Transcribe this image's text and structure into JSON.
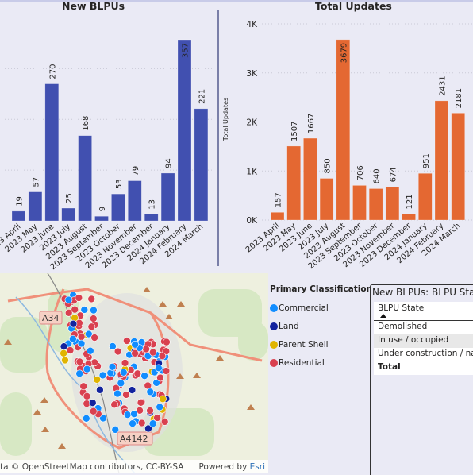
{
  "chart_data": [
    {
      "type": "bar",
      "title": "New BLPUs",
      "categories": [
        "2023 April",
        "2023 May",
        "2023 June",
        "2023 July",
        "2023 August",
        "2023 September",
        "2023 October",
        "2023 November",
        "2023 December",
        "2024 January",
        "2024 February",
        "2024 March"
      ],
      "values": [
        19,
        57,
        270,
        25,
        168,
        9,
        53,
        79,
        13,
        94,
        357,
        221
      ],
      "ylim": [
        0,
        357
      ],
      "grid": true,
      "color": "#4150b0",
      "xlabel": "",
      "ylabel": ""
    },
    {
      "type": "bar",
      "title": "Total Updates",
      "categories": [
        "2023 April",
        "2023 May",
        "2023 June",
        "2023 July",
        "2023 August",
        "2023 September",
        "2023 October",
        "2023 November",
        "2023 December",
        "2024 January",
        "2024 February",
        "2024 March"
      ],
      "values": [
        157,
        1507,
        1667,
        850,
        3679,
        706,
        640,
        674,
        121,
        951,
        2431,
        2181
      ],
      "ylim": [
        0,
        4000
      ],
      "yticks": [
        "0K",
        "1K",
        "2K",
        "3K",
        "4K"
      ],
      "grid": true,
      "color": "#e46832",
      "xlabel": "",
      "ylabel": "Total Updates"
    }
  ],
  "map": {
    "road_labels": [
      "A34",
      "A4142"
    ],
    "attribution": "ta © OpenStreetMap contributors, CC-BY-SA",
    "powered_by": "Powered by",
    "esri": "Esri"
  },
  "legend": {
    "title": "Primary Classification",
    "items": [
      {
        "label": "Commercial",
        "color": "#118dff"
      },
      {
        "label": "Land",
        "color": "#12239e"
      },
      {
        "label": "Parent Shell",
        "color": "#e0b400"
      },
      {
        "label": "Residential",
        "color": "#d9404f"
      }
    ]
  },
  "table": {
    "title": "New BLPUs: BLPU State",
    "column": "BLPU State",
    "rows": [
      "Demolished",
      "In use / occupied",
      "Under construction / name"
    ],
    "total": "Total"
  }
}
